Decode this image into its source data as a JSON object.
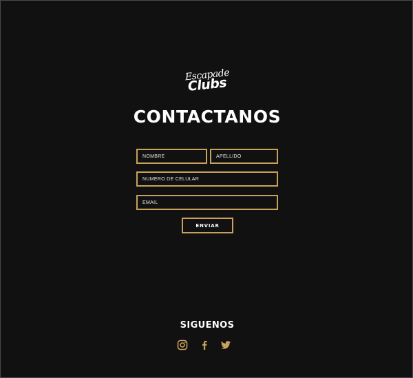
{
  "brand": {
    "logo_line1": "Escapade",
    "logo_line2": "Clubs"
  },
  "contact": {
    "title": "CONTACTANOS",
    "fields": {
      "nombre_placeholder": "NOMBRE",
      "apellido_placeholder": "APELLIDO",
      "celular_placeholder": "NUMERO DE CELULAR",
      "email_placeholder": "EMAIL"
    },
    "submit_label": "ENVIAR"
  },
  "social": {
    "heading": "SIGUENOS",
    "icons": [
      "instagram-icon",
      "facebook-icon",
      "twitter-icon"
    ]
  },
  "colors": {
    "background": "#121112",
    "accent": "#c8a25a",
    "text": "#ffffff"
  }
}
